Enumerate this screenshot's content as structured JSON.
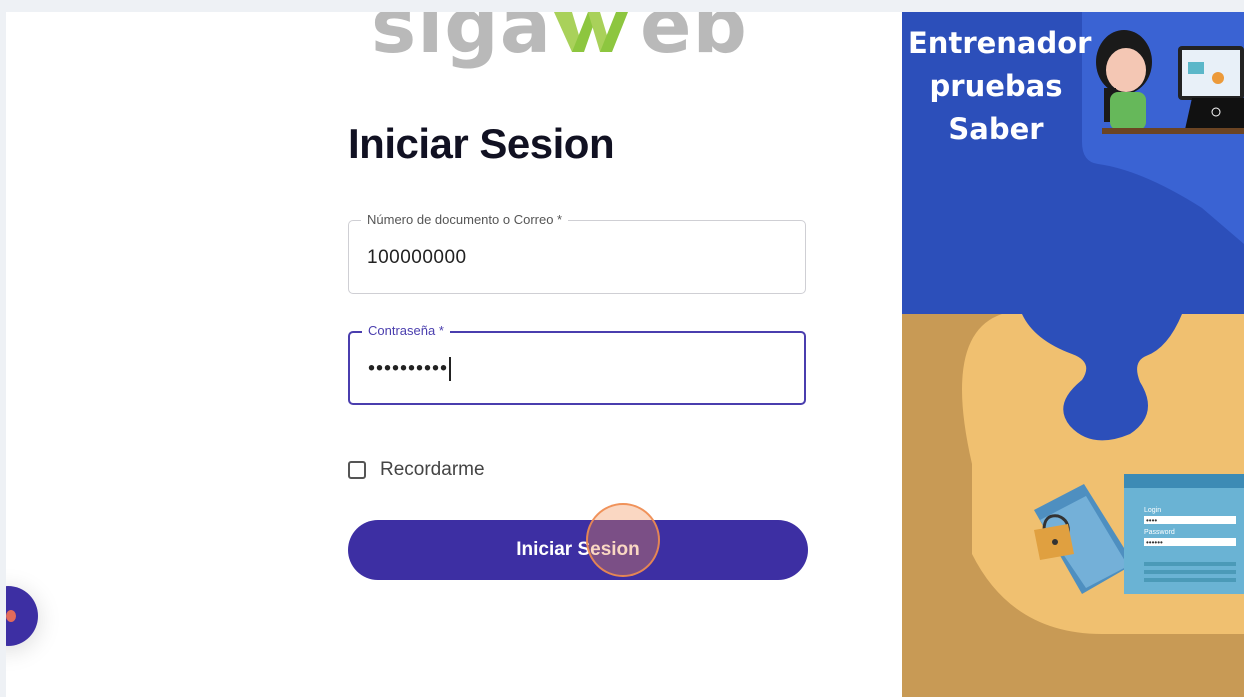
{
  "logo": {
    "text_left": "siga",
    "text_right": "eb"
  },
  "form": {
    "title": "Iniciar Sesion",
    "document_label": "Número de documento o Correo *",
    "document_value": "100000000",
    "password_label": "Contraseña *",
    "password_value": "••••••••••",
    "remember_label": "Recordarme",
    "submit_label": "Iniciar Sesion"
  },
  "banner": {
    "heading_lines": [
      "Entrenador",
      "pruebas",
      "Saber"
    ],
    "screen_login_label": "Login",
    "screen_password_label": "Password",
    "screen_login_dots": "••••",
    "screen_password_dots": "••••••"
  },
  "colors": {
    "primary": "#3d2fa3",
    "banner_blue": "#2c4fba",
    "banner_sand": "#c89a55",
    "logo_green": "#8dc63f"
  }
}
